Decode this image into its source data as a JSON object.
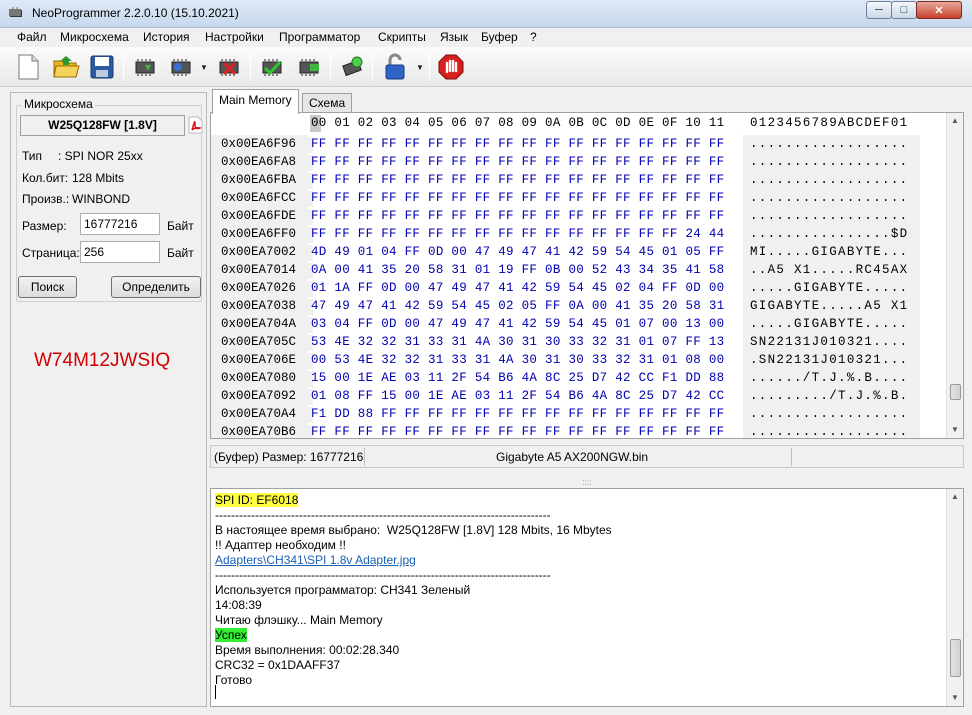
{
  "window": {
    "title": "NeoProgrammer 2.2.0.10 (15.10.2021)",
    "minimize": "─",
    "maximize": "□",
    "close": "✕"
  },
  "menu": [
    "Файл",
    "Микросхема",
    "История",
    "Настройки",
    "Программатор",
    "Скрипты",
    "Язык",
    "Буфер",
    "?"
  ],
  "toolbar": {
    "icons": [
      "new-file-icon",
      "open-folder-icon",
      "save-icon",
      "read-chip-icon",
      "write-chip-icon",
      "erase-chip-icon",
      "verify-chip-icon",
      "blank-check-icon",
      "auto-icon",
      "lock-icon",
      "stop-icon"
    ]
  },
  "chip": {
    "group_caption": "Микросхема",
    "name": "W25Q128FW [1.8V]",
    "type_label": "Тип",
    "type_value": ":  SPI NOR 25xx",
    "bits_label": "Кол.бит:",
    "bits_value": "128 Mbits",
    "vendor_label": "Произв.:",
    "vendor_value": "WINBOND",
    "size_label": "Размер:",
    "size_value": "16777216",
    "size_unit": "Байт",
    "page_label": "Страница:",
    "page_value": "256",
    "page_unit": "Байт",
    "search_button": "Поиск",
    "detect_button": "Определить",
    "marking": "W74M12JWSIQ"
  },
  "tabs": [
    "Main Memory",
    "Схема"
  ],
  "hex": {
    "header_bytes": "00 01 02 03 04 05 06 07 08 09 0A 0B 0C 0D 0E 0F 10 11",
    "header_ascii": "0123456789ABCDEF01",
    "rows": [
      {
        "addr": "0x00EA6F96",
        "bytes": "FF FF FF FF FF FF FF FF FF FF FF FF FF FF FF FF FF FF",
        "ascii": ".................."
      },
      {
        "addr": "0x00EA6FA8",
        "bytes": "FF FF FF FF FF FF FF FF FF FF FF FF FF FF FF FF FF FF",
        "ascii": ".................."
      },
      {
        "addr": "0x00EA6FBA",
        "bytes": "FF FF FF FF FF FF FF FF FF FF FF FF FF FF FF FF FF FF",
        "ascii": ".................."
      },
      {
        "addr": "0x00EA6FCC",
        "bytes": "FF FF FF FF FF FF FF FF FF FF FF FF FF FF FF FF FF FF",
        "ascii": ".................."
      },
      {
        "addr": "0x00EA6FDE",
        "bytes": "FF FF FF FF FF FF FF FF FF FF FF FF FF FF FF FF FF FF",
        "ascii": ".................."
      },
      {
        "addr": "0x00EA6FF0",
        "bytes": "FF FF FF FF FF FF FF FF FF FF FF FF FF FF FF FF 24 44",
        "ascii": "................$D"
      },
      {
        "addr": "0x00EA7002",
        "bytes": "4D 49 01 04 FF 0D 00 47 49 47 41 42 59 54 45 01 05 FF",
        "ascii": "MI.....GIGABYTE..."
      },
      {
        "addr": "0x00EA7014",
        "bytes": "0A 00 41 35 20 58 31 01 19 FF 0B 00 52 43 34 35 41 58",
        "ascii": "..A5 X1.....RC45AX"
      },
      {
        "addr": "0x00EA7026",
        "bytes": "01 1A FF 0D 00 47 49 47 41 42 59 54 45 02 04 FF 0D 00",
        "ascii": ".....GIGABYTE....."
      },
      {
        "addr": "0x00EA7038",
        "bytes": "47 49 47 41 42 59 54 45 02 05 FF 0A 00 41 35 20 58 31",
        "ascii": "GIGABYTE.....A5 X1"
      },
      {
        "addr": "0x00EA704A",
        "bytes": "03 04 FF 0D 00 47 49 47 41 42 59 54 45 01 07 00 13 00",
        "ascii": ".....GIGABYTE....."
      },
      {
        "addr": "0x00EA705C",
        "bytes": "53 4E 32 32 31 33 31 4A 30 31 30 33 32 31 01 07 FF 13",
        "ascii": "SN22131J010321...."
      },
      {
        "addr": "0x00EA706E",
        "bytes": "00 53 4E 32 32 31 33 31 4A 30 31 30 33 32 31 01 08 00",
        "ascii": ".SN22131J010321..."
      },
      {
        "addr": "0x00EA7080",
        "bytes": "15 00 1E AE 03 11 2F 54 B6 4A 8C 25 D7 42 CC F1 DD 88",
        "ascii": "....../T.J.%.B...."
      },
      {
        "addr": "0x00EA7092",
        "bytes": "01 08 FF 15 00 1E AE 03 11 2F 54 B6 4A 8C 25 D7 42 CC",
        "ascii": "........./T.J.%.B."
      },
      {
        "addr": "0x00EA70A4",
        "bytes": "F1 DD 88 FF FF FF FF FF FF FF FF FF FF FF FF FF FF FF",
        "ascii": ".................."
      },
      {
        "addr": "0x00EA70B6",
        "bytes": "FF FF FF FF FF FF FF FF FF FF FF FF FF FF FF FF FF FF",
        "ascii": ".................."
      }
    ]
  },
  "status": {
    "buffer_size": "(Буфер) Размер: 16777216",
    "filename": "Gigabyte A5 AX200NGW.bin"
  },
  "log": {
    "spi_id": "SPI ID: EF6018",
    "separator": "------------------------------------------------------------------------------------",
    "selected": "В настоящее время выбрано:  W25Q128FW [1.8V] 128 Mbits, 16 Mbytes",
    "adapter_needed": "!! Адаптер необходим !!",
    "adapter_link": "Adapters\\CH341\\SPI 1.8v Adapter.jpg",
    "programmer": "Используется программатор: CH341 Зеленый",
    "time": "14:08:39",
    "reading": "Читаю флэшку... Main Memory",
    "success": "Успех",
    "duration": "Время выполнения: 00:02:28.340",
    "crc": "CRC32 = 0x1DAAFF37",
    "done": "Готово"
  }
}
